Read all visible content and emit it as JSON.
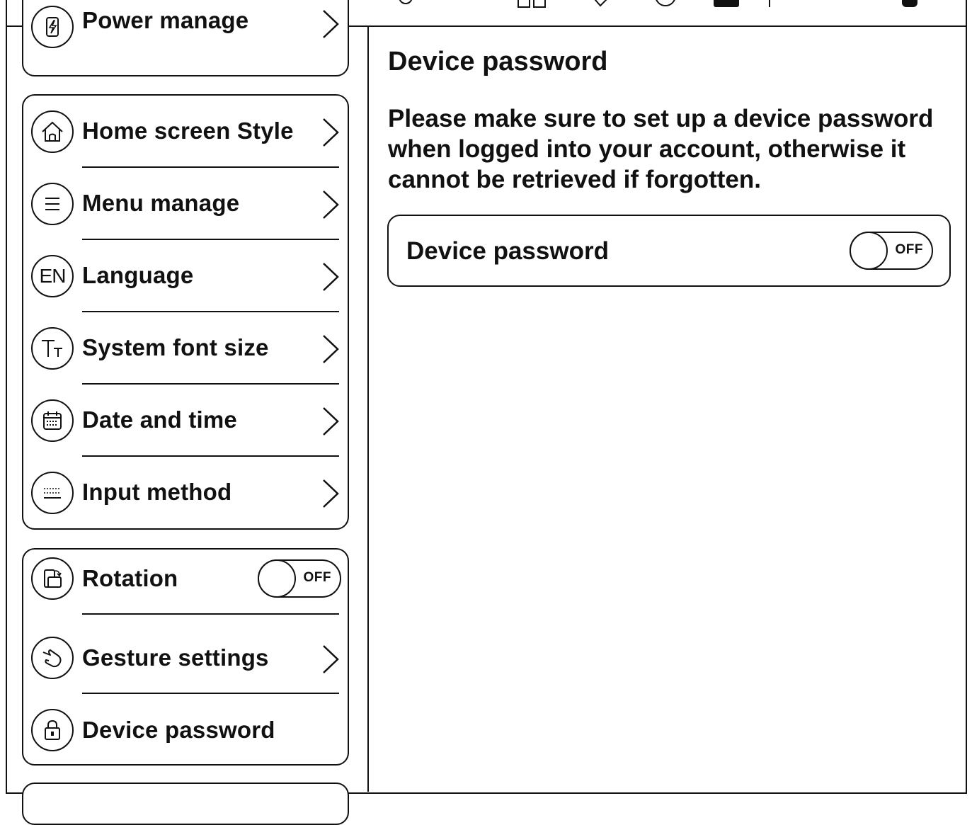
{
  "left_menu": {
    "power_manage": "Power manage",
    "group_display": [
      {
        "label": "Home screen Style",
        "icon": "home-icon"
      },
      {
        "label": "Menu manage",
        "icon": "menu-list-icon"
      },
      {
        "label": "Language",
        "icon": "language-icon",
        "icon_text": "EN"
      },
      {
        "label": "System font size",
        "icon": "font-size-icon"
      },
      {
        "label": "Date and time",
        "icon": "calendar-icon"
      },
      {
        "label": "Input method",
        "icon": "keyboard-icon"
      }
    ],
    "rotation": {
      "label": "Rotation",
      "toggle": "OFF"
    },
    "gesture_settings": "Gesture settings",
    "device_password": "Device password"
  },
  "detail": {
    "title": "Device password",
    "description": "Please make sure to set up a device password when logged into your account, otherwise it cannot be retrieved if forgotten.",
    "setting_label": "Device password",
    "setting_toggle": "OFF"
  }
}
